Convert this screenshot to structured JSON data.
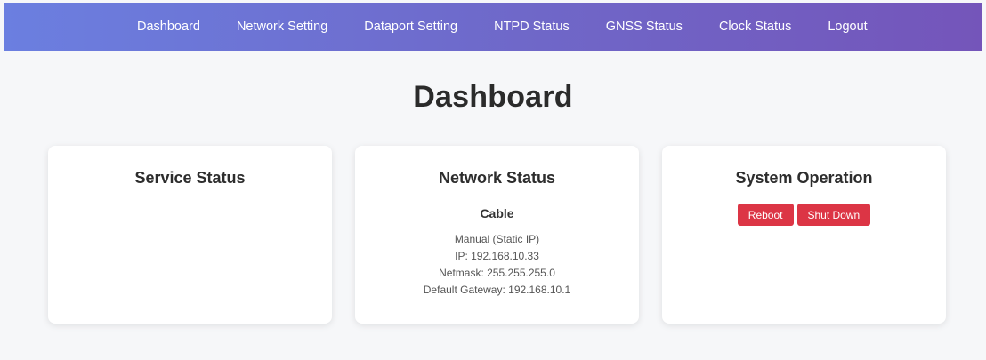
{
  "nav": {
    "items": [
      {
        "label": "Dashboard"
      },
      {
        "label": "Network Setting"
      },
      {
        "label": "Dataport Setting"
      },
      {
        "label": "NTPD Status"
      },
      {
        "label": "GNSS Status"
      },
      {
        "label": "Clock Status"
      },
      {
        "label": "Logout"
      }
    ]
  },
  "page": {
    "title": "Dashboard"
  },
  "cards": {
    "service": {
      "title": "Service Status"
    },
    "network": {
      "title": "Network Status",
      "type": "Cable",
      "mode": "Manual (Static IP)",
      "ip": "IP: 192.168.10.33",
      "netmask": "Netmask: 255.255.255.0",
      "gateway": "Default Gateway: 192.168.10.1"
    },
    "system": {
      "title": "System Operation",
      "reboot_label": "Reboot",
      "shutdown_label": "Shut Down"
    }
  },
  "colors": {
    "nav_gradient_start": "#6b7fe0",
    "nav_gradient_end": "#7455ba",
    "danger": "#dc3545",
    "background": "#f6f7f9"
  }
}
